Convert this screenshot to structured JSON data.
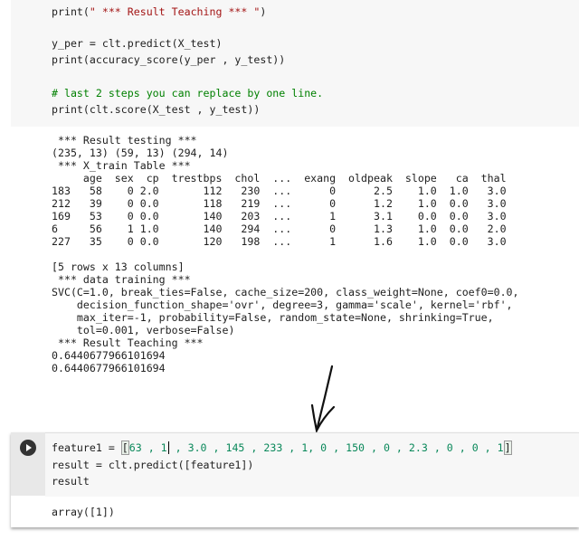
{
  "cell1": {
    "lines": [
      {
        "pre": "print(",
        "str": "\" *** Result Teaching *** \"",
        "post": ")"
      },
      "y_per = clt.predict(X_test)",
      "print(accuracy_score(y_per , y_test))",
      "# last 2 steps you can replace by one line.",
      "print(clt.score(X_test , y_test))"
    ],
    "output": " *** Result testing ***\n(235, 13) (59, 13) (294, 14)\n *** X_train Table ***\n     age  sex  cp  trestbps  chol  ...  exang  oldpeak  slope   ca  thal\n183   58    0 2.0       112   230  ...      0      2.5    1.0  1.0   3.0\n212   39    0 0.0       118   219  ...      0      1.2    1.0  0.0   3.0\n169   53    0 0.0       140   203  ...      1      3.1    0.0  0.0   3.0\n6     56    1 1.0       140   294  ...      0      1.3    1.0  0.0   2.0\n227   35    0 0.0       120   198  ...      1      1.6    1.0  0.0   3.0\n\n[5 rows x 13 columns]\n *** data training ***\nSVC(C=1.0, break_ties=False, cache_size=200, class_weight=None, coef0=0.0,\n    decision_function_shape='ovr', degree=3, gamma='scale', kernel='rbf',\n    max_iter=-1, probability=False, random_state=None, shrinking=True,\n    tol=0.001, verbose=False)\n *** Result Teaching ***\n0.6440677966101694\n0.6440677966101694"
  },
  "cell2": {
    "line1_prefix": "feature1 = ",
    "open_bracket": "[",
    "v1": "63 , 1",
    "rest": " , 3.0 , 145 , 233 , 1, 0 , 150 , 0 , 2.3 , 0 , 0 , 1",
    "close_bracket": "]",
    "line2": "result = clt.predict([feature1])",
    "line3": "result",
    "output": "array([1])"
  }
}
